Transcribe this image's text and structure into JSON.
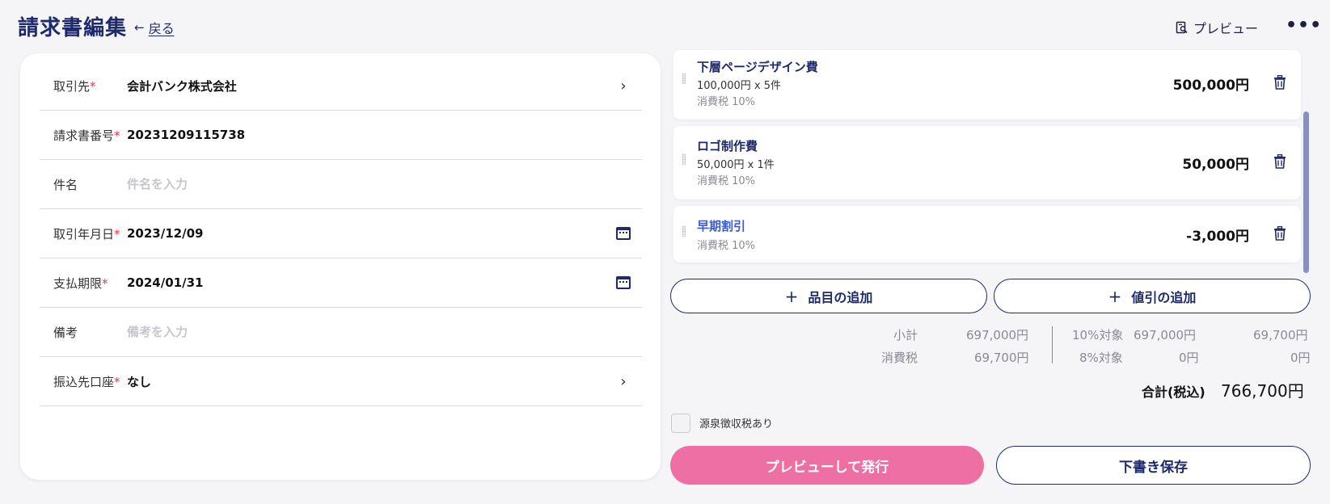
{
  "header": {
    "title": "請求書編集",
    "back_label": "戻る",
    "preview_label": "プレビュー",
    "more_icon": "more-horizontal-icon"
  },
  "form": {
    "client_label": "取引先",
    "client_value": "会計バンク株式会社",
    "invoice_no_label": "請求書番号",
    "invoice_no_value": "20231209115738",
    "subject_label": "件名",
    "subject_placeholder": "件名を入力",
    "date_label": "取引年月日",
    "date_value": "2023/12/09",
    "due_label": "支払期限",
    "due_value": "2024/01/31",
    "note_label": "備考",
    "note_placeholder": "備考を入力",
    "account_label": "振込先口座",
    "account_value": "なし",
    "required_mark": "*"
  },
  "items": [
    {
      "name": "下層ページデザイン費",
      "qty": "100,000円 x 5件",
      "tax": "消費税 10%",
      "amount": "500,000円"
    },
    {
      "name": "ロゴ制作費",
      "qty": "50,000円 x 1件",
      "tax": "消費税 10%",
      "amount": "50,000円"
    },
    {
      "name": "早期割引",
      "tax": "消費税 10%",
      "amount": "-3,000円"
    }
  ],
  "actions": {
    "add_item": "品目の追加",
    "add_discount": "値引の追加",
    "issue": "プレビューして発行",
    "save_draft": "下書き保存"
  },
  "summary": {
    "subtotal_label": "小計",
    "subtotal_value": "697,000円",
    "tax_label": "消費税",
    "tax_value": "69,700円",
    "rate10_label": "10%対象",
    "rate10_base": "697,000円",
    "rate10_tax": "69,700円",
    "rate8_label": "8%対象",
    "rate8_base": "0円",
    "rate8_tax": "0円",
    "total_label": "合計(税込)",
    "total_value": "766,700円"
  },
  "withholding": {
    "label": "源泉徴収税あり"
  },
  "colors": {
    "navy": "#1f2a6b",
    "pink": "#ed6fa4",
    "discount_blue": "#3c5bd6",
    "required_red": "#e0364d"
  }
}
